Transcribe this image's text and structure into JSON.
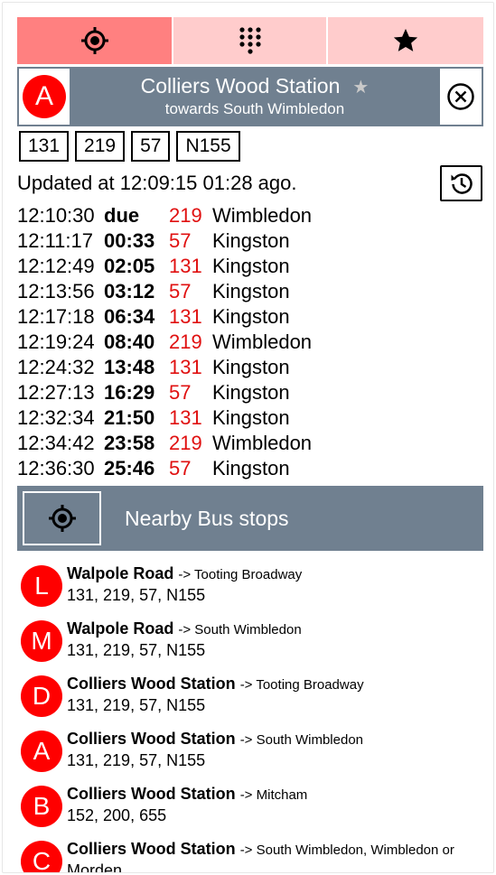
{
  "tabs": [
    {
      "icon": "locate-icon",
      "active": true
    },
    {
      "icon": "keypad-icon",
      "active": false
    },
    {
      "icon": "star-icon",
      "active": false
    }
  ],
  "stop": {
    "letter": "A",
    "name": "Colliers Wood Station",
    "fav_symbol": "★",
    "towards": "towards South Wimbledon",
    "routes": [
      "131",
      "219",
      "57",
      "N155"
    ]
  },
  "updated": "Updated at 12:09:15 01:28 ago.",
  "arrivals": [
    {
      "time": "12:10:30",
      "due": "due",
      "route": "219",
      "dest": "Wimbledon"
    },
    {
      "time": "12:11:17",
      "due": "00:33",
      "route": "57",
      "dest": "Kingston"
    },
    {
      "time": "12:12:49",
      "due": "02:05",
      "route": "131",
      "dest": "Kingston"
    },
    {
      "time": "12:13:56",
      "due": "03:12",
      "route": "57",
      "dest": "Kingston"
    },
    {
      "time": "12:17:18",
      "due": "06:34",
      "route": "131",
      "dest": "Kingston"
    },
    {
      "time": "12:19:24",
      "due": "08:40",
      "route": "219",
      "dest": "Wimbledon"
    },
    {
      "time": "12:24:32",
      "due": "13:48",
      "route": "131",
      "dest": "Kingston"
    },
    {
      "time": "12:27:13",
      "due": "16:29",
      "route": "57",
      "dest": "Kingston"
    },
    {
      "time": "12:32:34",
      "due": "21:50",
      "route": "131",
      "dest": "Kingston"
    },
    {
      "time": "12:34:42",
      "due": "23:58",
      "route": "219",
      "dest": "Wimbledon"
    },
    {
      "time": "12:36:30",
      "due": "25:46",
      "route": "57",
      "dest": "Kingston"
    }
  ],
  "nearby": {
    "title": "Nearby Bus stops",
    "stops": [
      {
        "letter": "L",
        "name": "Walpole Road",
        "towards": "-> Tooting Broadway",
        "routes": "131, 219, 57, N155"
      },
      {
        "letter": "M",
        "name": "Walpole Road",
        "towards": "-> South Wimbledon",
        "routes": "131, 219, 57, N155"
      },
      {
        "letter": "D",
        "name": "Colliers Wood Station",
        "towards": "-> Tooting Broadway",
        "routes": "131, 219, 57, N155"
      },
      {
        "letter": "A",
        "name": "Colliers Wood Station",
        "towards": "-> South Wimbledon",
        "routes": "131, 219, 57, N155"
      },
      {
        "letter": "B",
        "name": "Colliers Wood Station",
        "towards": "-> Mitcham",
        "routes": "152, 200, 655"
      },
      {
        "letter": "C",
        "name": "Colliers Wood Station",
        "towards": "-> South Wimbledon, Wimbledon or",
        "routes": "Morden"
      }
    ]
  },
  "colors": {
    "tab_active": "#ff8080",
    "tab_inactive": "#ffcccc",
    "slate": "#708090",
    "stop_red": "#ff0000",
    "route_red": "#e01010"
  }
}
